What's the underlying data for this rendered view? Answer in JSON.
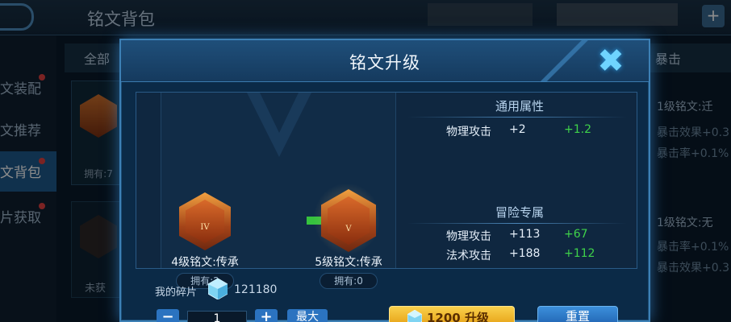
{
  "background": {
    "title": "铭文背包",
    "sidebar": [
      {
        "label": "文装配",
        "badge": true
      },
      {
        "label": "文推荐",
        "badge": false
      },
      {
        "label": "文背包",
        "badge": true,
        "active": true
      },
      {
        "label": "片获取",
        "badge": true
      }
    ],
    "tabs": {
      "all": "全部",
      "right": "暴击"
    },
    "card_own": "拥有:7",
    "card2_text": "未获",
    "right_lines": [
      "1级铭文:迁",
      "暴击效果+0.3",
      "暴击率+0.1%",
      "1级铭文:无",
      "暴击率+0.1%",
      "暴击效果+0.3"
    ]
  },
  "modal": {
    "title": "铭文升级",
    "close_icon": "close-icon",
    "current": {
      "name": "4级铭文:传承",
      "owned": "拥有:2",
      "mark": "IV"
    },
    "next": {
      "name": "5级铭文:传承",
      "owned": "拥有:0",
      "mark": "V"
    },
    "general": {
      "title": "通用属性",
      "rows": [
        {
          "name": "物理攻击",
          "value": "+2",
          "increase": "+1.2"
        }
      ]
    },
    "adventure": {
      "title": "冒险专属",
      "rows": [
        {
          "name": "物理攻击",
          "value": "+113",
          "increase": "+67"
        },
        {
          "name": "法术攻击",
          "value": "+188",
          "increase": "+112"
        }
      ]
    },
    "shards": {
      "label": "我的碎片",
      "count": "121180"
    },
    "quantity": {
      "minus": "−",
      "value": "1",
      "plus": "+",
      "max": "最大"
    },
    "upgrade_button": "1200 升级",
    "reset_button": "重置"
  },
  "colors": {
    "accent": "#2b73c0",
    "increase": "#3fd24a",
    "gold": "#f9d04c"
  }
}
